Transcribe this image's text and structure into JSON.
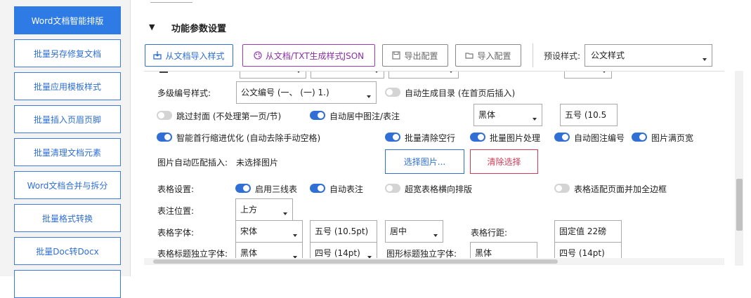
{
  "sidebar": {
    "items": [
      {
        "label": "Word文档智能排版",
        "active": true
      },
      {
        "label": "批量另存修复文档",
        "active": false
      },
      {
        "label": "批量应用模板样式",
        "active": false
      },
      {
        "label": "批量插入页眉页脚",
        "active": false
      },
      {
        "label": "批量清理文档元素",
        "active": false
      },
      {
        "label": "Word文档合并与拆分",
        "active": false
      },
      {
        "label": "批量格式转换",
        "active": false
      },
      {
        "label": "批量Doc转Docx",
        "active": false
      }
    ]
  },
  "section": {
    "title": "功能参数设置",
    "collapse_glyph": "▼"
  },
  "toolbar": {
    "import_style": "从文档导入样式",
    "gen_json": "从文档/TXT生成样式JSON",
    "export_config": "导出配置",
    "import_config": "导入配置",
    "preset_label": "预设样式:",
    "preset_value": "公文样式"
  },
  "params": {
    "multilevel_label": "多级编号样式:",
    "multilevel_value": "公文编号 (一、 (一) 1.)",
    "auto_toc": {
      "label": "自动生成目录 (在首页后插入)",
      "on": false
    },
    "skip_cover": {
      "label": "跳过封面 (不处理第一页/节)",
      "on": false
    },
    "center_caption": {
      "label": "自动居中图注/表注",
      "on": true
    },
    "caption_font": "黑体",
    "caption_size": "五号 (10.5",
    "smart_indent": {
      "label": "智能首行缩进优化 (自动去除手动空格)",
      "on": true
    },
    "clear_empty": {
      "label": "批量清除空行",
      "on": true
    },
    "image_process": {
      "label": "批量图片处理",
      "on": true
    },
    "auto_fig_num": {
      "label": "自动图注编号",
      "on": true
    },
    "img_full_width": {
      "label": "图片满页宽",
      "on": true
    },
    "img_insert_label": "图片自动匹配插入:",
    "img_insert_value": "未选择图片",
    "choose_image": "选择图片...",
    "clear_selection": "清除选择",
    "table_settings_label": "表格设置:",
    "three_line": {
      "label": "启用三线表",
      "on": true
    },
    "auto_table_note": {
      "label": "自动表注",
      "on": true
    },
    "wide_table_landscape": {
      "label": "超宽表格横向排版",
      "on": false
    },
    "table_fit_page": {
      "label": "表格适配页面并加全边框",
      "on": false
    },
    "note_pos_label": "表注位置:",
    "note_pos_value": "上方",
    "table_font_label": "表格字体:",
    "table_font_value": "宋体",
    "table_size_value": "五号 (10.5pt)",
    "table_align_value": "居中",
    "row_spacing_label": "表格行距:",
    "row_spacing_value": "固定值 22磅",
    "table_title_font_label": "表格标题独立字体:",
    "table_title_font_value": "黑体",
    "table_title_size_value": "四号 (14pt)",
    "figure_title_font_label": "图形标题独立字体:",
    "figure_title_font_value": "黑体",
    "figure_title_size_value": "四号 (14pt)"
  },
  "colors": {
    "accent": "#2f7be6",
    "purple": "#9b3bb6",
    "danger": "#d23b58"
  }
}
